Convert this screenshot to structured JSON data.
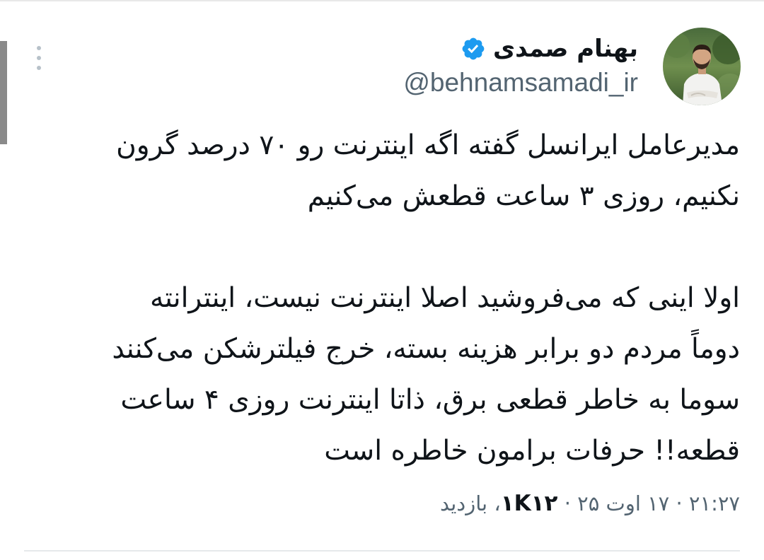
{
  "author": {
    "display_name": "بهنام صمدی",
    "handle": "@behnamsamadi_ir",
    "verified": true,
    "avatar_icon": "profile-photo"
  },
  "tweet": {
    "paragraphs": [
      [
        "مدیرعامل ایرانسل گفته اگه اینترنت رو ۷۰ درصد گرون",
        "نکنیم، روزی ۳ ساعت قطعش می‌کنیم"
      ],
      [
        "اولا اینی که می‌فروشید اصلا اینترنت نیست، اینترانته",
        "دوماً مردم دو برابر هزینه بسته، خرج فیلترشکن می‌کنند",
        "سوما به خاطر قطعی برق، ذاتا اینترنت روزی ۴ ساعت",
        "قطعه!! حرفات برامون خاطره است"
      ]
    ]
  },
  "meta": {
    "time": "۲۱:۲۷",
    "date": "۱۷ اوت ۲۵",
    "views_count": "۱K۱۲",
    "views_label": "، بازدید",
    "separator": "·"
  },
  "icons": {
    "more": "more-vertical-icon",
    "verified": "verified-badge-icon"
  },
  "colors": {
    "verified_blue": "#1d9bf0",
    "text_primary": "#0f1419",
    "text_secondary": "#536471"
  }
}
